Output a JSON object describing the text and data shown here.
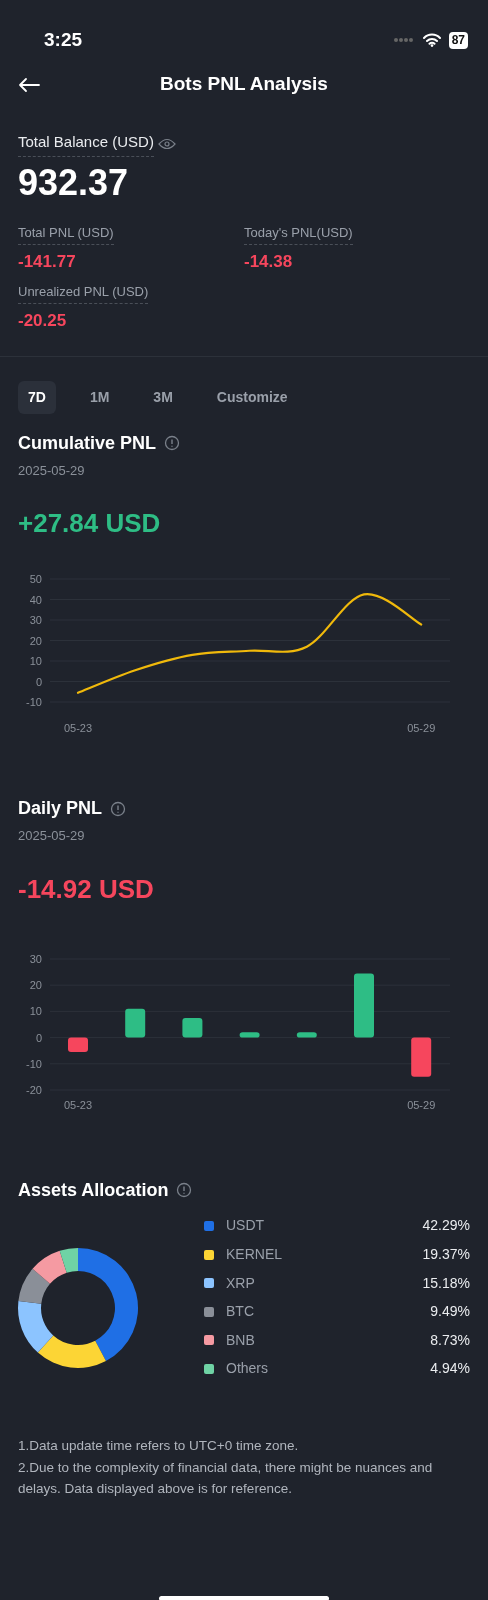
{
  "status_bar": {
    "time": "3:25",
    "battery": "87"
  },
  "header": {
    "title": "Bots PNL Analysis"
  },
  "balance": {
    "label": "Total Balance (USD)",
    "value": "932.37"
  },
  "stats": [
    {
      "label": "Total PNL (USD)",
      "value": "-141.77",
      "negative": true
    },
    {
      "label": "Today's PNL(USD)",
      "value": "-14.38",
      "negative": true
    },
    {
      "label": "Unrealized PNL (USD)",
      "value": "-20.25",
      "negative": true
    }
  ],
  "tabs": [
    {
      "label": "7D",
      "selected": true
    },
    {
      "label": "1M",
      "selected": false
    },
    {
      "label": "3M",
      "selected": false
    },
    {
      "label": "Customize",
      "selected": false
    }
  ],
  "cumulative": {
    "title": "Cumulative PNL",
    "date": "2025-05-29",
    "value": "+27.84 USD",
    "negative": false,
    "chart_data": {
      "type": "line",
      "categories": [
        "05-23",
        null,
        null,
        null,
        null,
        null,
        "05-29"
      ],
      "series": [
        {
          "color": "#f0b90b",
          "values": [
            -5.5,
            5.5,
            13,
            15,
            17,
            42.5,
            27.8
          ]
        }
      ],
      "grid": true,
      "ylim": [
        -10,
        50
      ],
      "yticks": [
        -10,
        0,
        10,
        20,
        30,
        40,
        50
      ]
    }
  },
  "daily": {
    "title": "Daily PNL",
    "date": "2025-05-29",
    "value": "-14.92 USD",
    "negative": true,
    "chart_data": {
      "type": "bar",
      "categories": [
        "05-23",
        null,
        null,
        null,
        null,
        null,
        "05-29"
      ],
      "series": [
        {
          "color": "#2ebd85",
          "values": [
            null,
            11,
            7.5,
            2,
            2,
            24.5,
            null
          ]
        },
        {
          "color": "#f6465d",
          "values": [
            -5.5,
            null,
            null,
            null,
            null,
            null,
            -14.9
          ]
        }
      ],
      "stacked": true,
      "grid": true,
      "ylim": [
        -20,
        30
      ],
      "yticks": [
        -20,
        -10,
        0,
        10,
        20,
        30
      ]
    }
  },
  "allocation": {
    "title": "Assets Allocation",
    "chart_data": {
      "type": "donut",
      "categories": [
        "USDT",
        "KERNEL",
        "XRP",
        "BTC",
        "BNB",
        "Others"
      ],
      "series": [
        {
          "values": [
            42.29,
            19.37,
            15.18,
            9.49,
            8.73,
            4.94
          ]
        }
      ]
    },
    "legend": [
      {
        "percent": "42.29%",
        "color": "#1f6fe5"
      },
      {
        "percent": "19.37%",
        "color": "#fcd535"
      },
      {
        "percent": "15.18%",
        "color": "#8cc4ff"
      },
      {
        "percent": "9.49%",
        "color": "#8a8f98"
      },
      {
        "percent": "8.73%",
        "color": "#f59aa2"
      },
      {
        "percent": "4.94%",
        "color": "#6fd3a5"
      }
    ]
  },
  "notes": [
    "1.Data update time refers to UTC+0 time zone.",
    "2.Due to the complexity of financial data, there might be nuances and delays. Data displayed above is for reference."
  ]
}
